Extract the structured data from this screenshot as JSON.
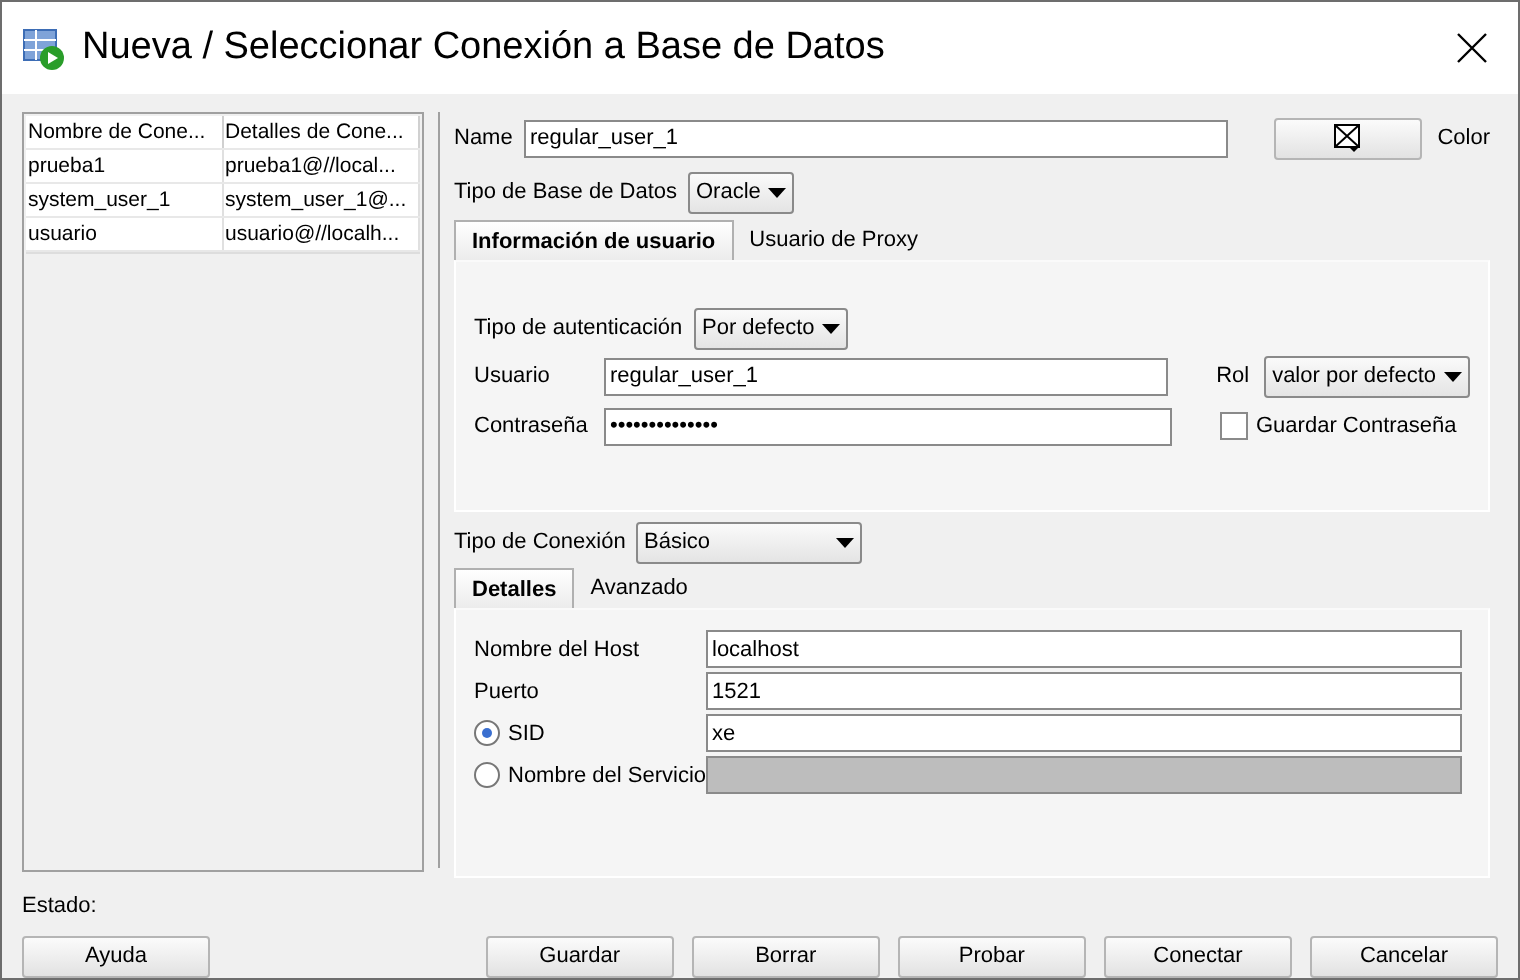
{
  "window": {
    "title": "Nueva / Seleccionar Conexión a Base de Datos"
  },
  "connections": {
    "columns": [
      "Nombre de Cone...",
      "Detalles de Cone..."
    ],
    "rows": [
      {
        "cells": [
          "prueba1",
          "prueba1@//local..."
        ],
        "selected": false
      },
      {
        "cells": [
          "system_user_1",
          "system_user_1@..."
        ],
        "selected": false
      },
      {
        "cells": [
          "usuario",
          "usuario@//localh..."
        ],
        "selected": false
      }
    ]
  },
  "name": {
    "label": "Name",
    "value": "regular_user_1"
  },
  "color": {
    "label": "Color"
  },
  "db_type": {
    "label": "Tipo de Base de Datos",
    "value": "Oracle"
  },
  "user_tabs": [
    {
      "label": "Información de usuario",
      "selected": true
    },
    {
      "label": "Usuario de Proxy",
      "selected": false
    }
  ],
  "auth_type": {
    "label": "Tipo de autenticación",
    "value": "Por defecto"
  },
  "user": {
    "label": "Usuario",
    "value": "regular_user_1"
  },
  "password": {
    "label": "Contraseña",
    "value": "••••••••••••••"
  },
  "role": {
    "label": "Rol",
    "value": "valor por defecto"
  },
  "save_password": {
    "label": "Guardar Contraseña",
    "checked": false
  },
  "connection_type": {
    "label": "Tipo de Conexión",
    "value": "Básico"
  },
  "detail_tabs": [
    {
      "label": "Detalles",
      "selected": true
    },
    {
      "label": "Avanzado",
      "selected": false
    }
  ],
  "details": [
    {
      "kind": "label",
      "label": "Nombre del Host",
      "value": "localhost",
      "disabled": false
    },
    {
      "kind": "label",
      "label": "Puerto",
      "value": "1521",
      "disabled": false
    },
    {
      "kind": "radio",
      "label": "SID",
      "selected": true,
      "value": "xe",
      "disabled": false
    },
    {
      "kind": "radio",
      "label": "Nombre del Servicio",
      "selected": false,
      "disabled": true
    }
  ],
  "status": {
    "label": "Estado:"
  },
  "buttons": [
    {
      "label": "Ayuda"
    },
    {
      "label": "Guardar"
    },
    {
      "label": "Borrar"
    },
    {
      "label": "Probar"
    },
    {
      "label": "Conectar"
    },
    {
      "label": "Cancelar"
    }
  ]
}
